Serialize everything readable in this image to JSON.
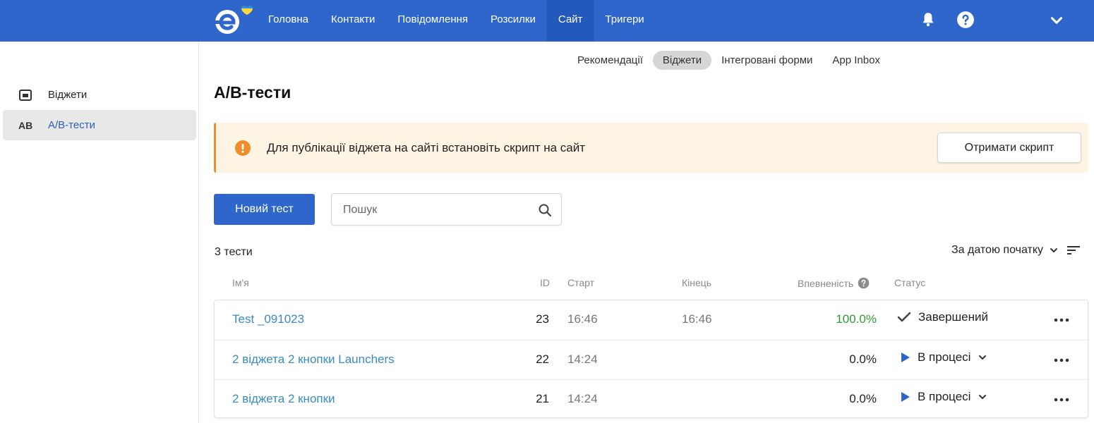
{
  "colors": {
    "brand": "#2f66cc",
    "link": "#3a8ac4",
    "success": "#2f9a32",
    "warning": "#ef8d2a"
  },
  "nav": {
    "items": [
      {
        "label": "Головна"
      },
      {
        "label": "Контакти"
      },
      {
        "label": "Повідомлення"
      },
      {
        "label": "Розсилки"
      },
      {
        "label": "Сайт"
      },
      {
        "label": "Тригери"
      }
    ],
    "active": "Сайт",
    "icons": [
      "bell-icon",
      "help-icon",
      "chevron-down-icon"
    ]
  },
  "sidebar": {
    "items": [
      {
        "icon": "widget-icon",
        "label": "Віджети"
      },
      {
        "icon_text": "AB",
        "label": "А/В-тести"
      }
    ]
  },
  "subtabs": {
    "items": [
      {
        "label": "Рекомендації"
      },
      {
        "label": "Віджети"
      },
      {
        "label": "Інтегровані форми"
      },
      {
        "label": "App Inbox"
      }
    ],
    "active": "Віджети"
  },
  "page": {
    "title": "А/В-тести"
  },
  "alert": {
    "text": "Для публікації віджета на сайті встановіть скрипт на сайт",
    "button": "Отримати скрипт"
  },
  "toolbar": {
    "new_test": "Новий тест",
    "search_placeholder": "Пошук"
  },
  "list": {
    "count": "3 тести",
    "sort_label": "За датою початку",
    "columns": {
      "name": "Ім'я",
      "id": "ID",
      "start": "Старт",
      "end": "Кінець",
      "confidence": "Впевненість",
      "status": "Статус"
    },
    "rows": [
      {
        "name": "Test _091023",
        "id": "23",
        "start": "16:46",
        "end": "16:46",
        "confidence": "100.0%",
        "status": "Завершений"
      },
      {
        "name": "2 віджета 2 кнопки Launchers",
        "id": "22",
        "start": "14:24",
        "end": "",
        "confidence": "0.0%",
        "status": "В процесі"
      },
      {
        "name": "2 віджета 2 кнопки",
        "id": "21",
        "start": "14:24",
        "end": "",
        "confidence": "0.0%",
        "status": "В процесі"
      }
    ]
  }
}
